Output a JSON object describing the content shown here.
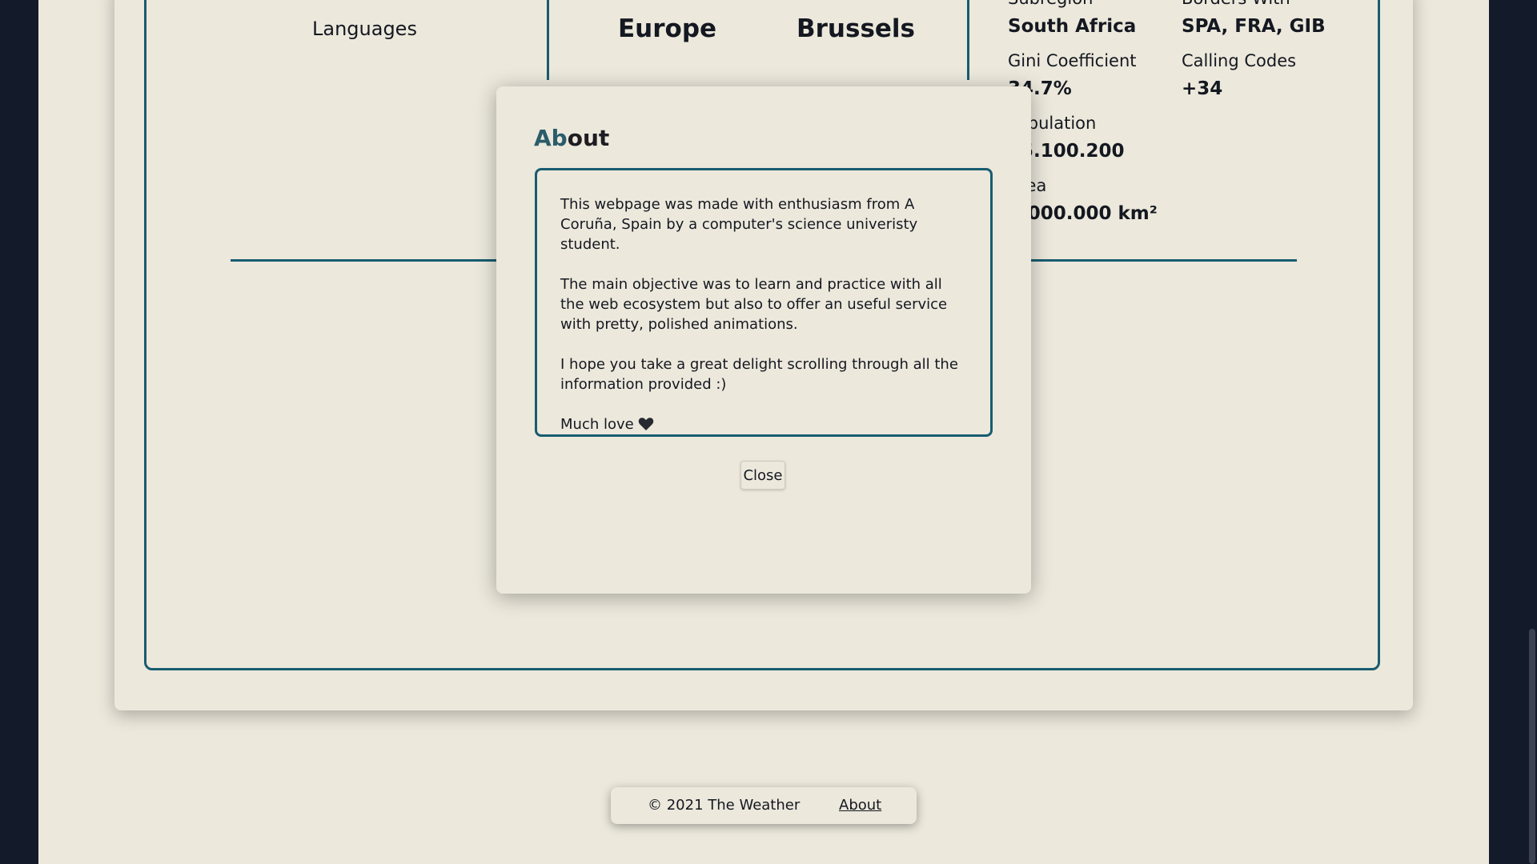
{
  "country": {
    "languages_label": "Languages",
    "region": "Europe",
    "capital": "Brussels",
    "subregion_label": "Subregion",
    "subregion_value": "South Africa",
    "borders_label": "Borders With",
    "borders_value": "SPA, FRA, GIB",
    "gini_label": "Gini Coefficient",
    "gini_value": "34.7%",
    "calling_label": "Calling Codes",
    "calling_value": "+34",
    "population_label": "Population",
    "population_value": "45.100.200",
    "area_label": "Area",
    "area_value": "1.000.000 km²"
  },
  "modal": {
    "title_accent": "Ab",
    "title_rest": "out",
    "paragraph_1": "This webpage was made with enthusiasm from A Coruña, Spain by a computer's science univeristy student.",
    "paragraph_2": "The main objective was to learn and practice with all the web ecosystem but also to offer an useful service with pretty, polished animations.",
    "paragraph_3": "I hope you take a great delight scrolling through all the information provided :)",
    "sign_off": "Much love",
    "close_label": "Close",
    "icon": "heart-icon"
  },
  "footer": {
    "copyright": "© 2021 The Weather",
    "about_link": "About"
  },
  "colors": {
    "background": "#131a2a",
    "surface": "#ece8dc",
    "accent": "#185c70",
    "title_accent": "#2b5c6a"
  }
}
